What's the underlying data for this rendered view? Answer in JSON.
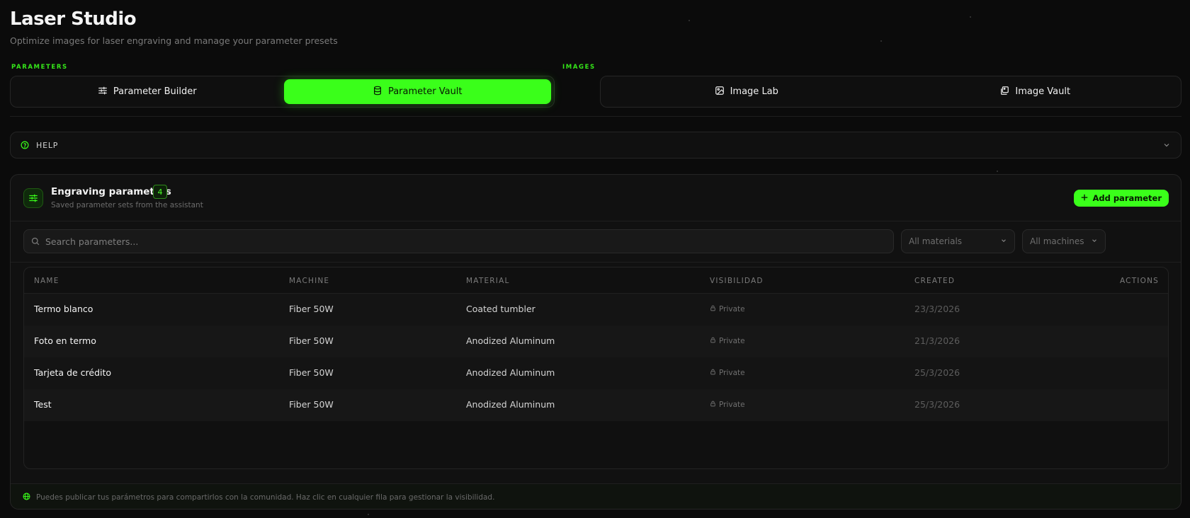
{
  "header": {
    "title": "Laser Studio",
    "subtitle": "Optimize images for laser engraving and manage your parameter presets"
  },
  "sections": {
    "parameters_label": "PARAMETERS",
    "images_label": "IMAGES"
  },
  "tabs": {
    "parameter_builder": "Parameter Builder",
    "parameter_vault": "Parameter Vault",
    "image_lab": "Image Lab",
    "image_vault": "Image Vault",
    "active": "parameter_vault"
  },
  "help": {
    "label": "HELP"
  },
  "card": {
    "title": "Engraving parameters",
    "count": "4",
    "subtitle": "Saved parameter sets from the assistant",
    "add_label": "Add parameter"
  },
  "filters": {
    "search_placeholder": "Search parameters...",
    "materials": "All materials",
    "machines": "All machines"
  },
  "table": {
    "columns": {
      "name": "NAME",
      "machine": "MACHINE",
      "material": "MATERIAL",
      "visibility": "VISIBILIDAD",
      "created": "CREATED",
      "actions": "ACTIONS"
    },
    "rows": [
      {
        "name": "Termo blanco",
        "machine": "Fiber 50W",
        "material": "Coated tumbler",
        "visibility": "Private",
        "created": "23/3/2026"
      },
      {
        "name": "Foto en termo",
        "machine": "Fiber 50W",
        "material": "Anodized Aluminum",
        "visibility": "Private",
        "created": "21/3/2026"
      },
      {
        "name": "Tarjeta de crédito",
        "machine": "Fiber 50W",
        "material": "Anodized Aluminum",
        "visibility": "Private",
        "created": "25/3/2026"
      },
      {
        "name": "Test",
        "machine": "Fiber 50W",
        "material": "Anodized Aluminum",
        "visibility": "Private",
        "created": "25/3/2026"
      }
    ]
  },
  "footer": {
    "note": "Puedes publicar tus parámetros para compartirlos con la comunidad. Haz clic en cualquier fila para gestionar la visibilidad."
  },
  "colors": {
    "accent": "#3aff1a",
    "background": "#0b0b0b",
    "card": "#111111"
  },
  "icons": {
    "parameter_builder": "sliders-icon",
    "parameter_vault": "database-icon",
    "image_lab": "image-icon",
    "image_vault": "images-icon",
    "help": "help-circle-icon",
    "search": "search-icon",
    "lock": "lock-icon",
    "globe": "globe-icon"
  }
}
